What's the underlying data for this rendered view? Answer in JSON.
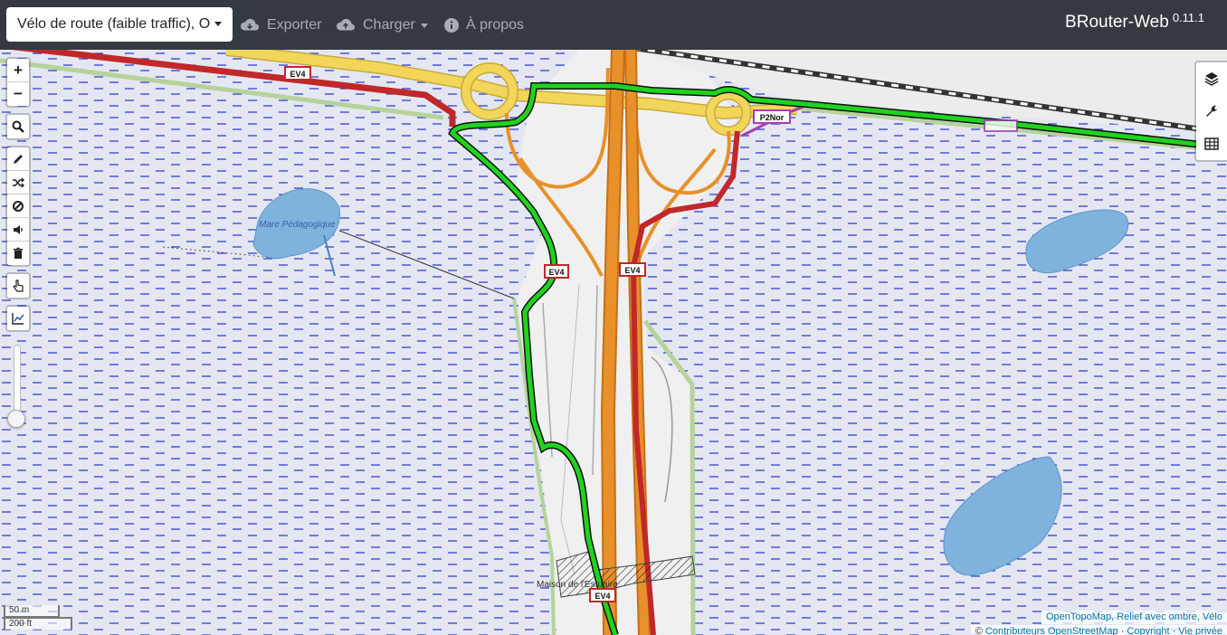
{
  "navbar": {
    "profile": "Vélo de route (faible traffic), O",
    "export_label": "Exporter",
    "load_label": "Charger",
    "about_label": "À propos",
    "brand_name": "BRouter-Web",
    "version": "0.11.1"
  },
  "map": {
    "labels": {
      "pond": "Mare Pédagogique",
      "house": "Maison de l'Estuaire",
      "route_ev4_a": "EV4",
      "route_ev4_b": "EV4",
      "route_ev4_c": "EV4",
      "route_ev4_d": "EV4",
      "route_p2nor": "P2Nor"
    },
    "colors": {
      "route_track": "#1fd31f",
      "water": "#7fb3de",
      "wetland_dash": "#1a2bd0",
      "motorway": "#e8902a",
      "cycle_route": "#c0282a",
      "yellow_road": "#f2d65a"
    }
  },
  "controls": {
    "zoom_in": "+",
    "zoom_out": "−",
    "icons": [
      "search-icon",
      "pencil-icon",
      "shuffle-icon",
      "no-entry-icon",
      "speaker-icon",
      "trash-icon",
      "pointer-icon",
      "chart-icon"
    ],
    "right_icons": [
      "layers-icon",
      "wrench-icon",
      "table-icon"
    ]
  },
  "scale": {
    "metric": "50 m",
    "imperial": "200 ft"
  },
  "attribution": {
    "layers": "OpenTopoMap, Relief avec ombre, Vélo",
    "copyright_symbol": "©",
    "contributors": "Contributeurs OpenStreetMap",
    "copyright_link": "Copyright",
    "privacy_link": "Vie privée"
  }
}
